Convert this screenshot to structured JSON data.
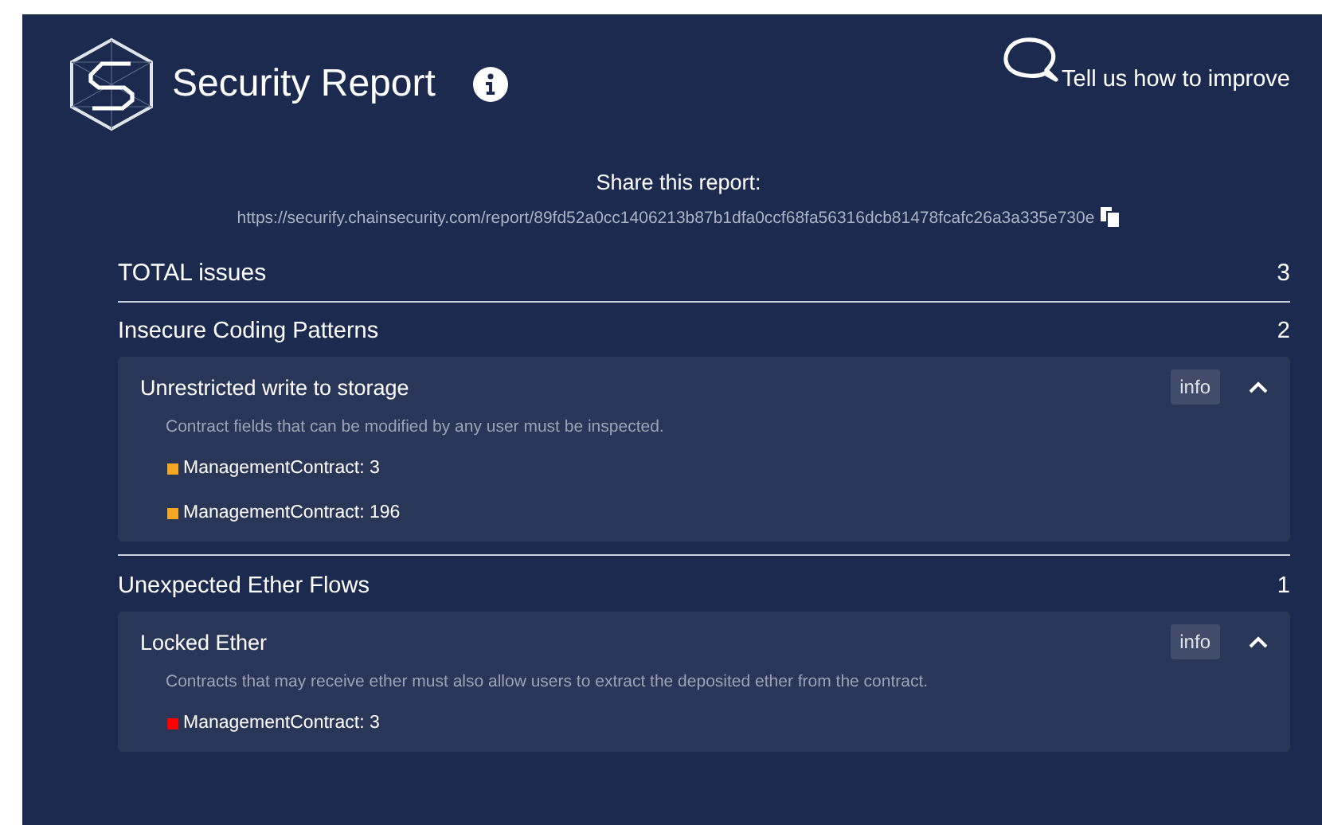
{
  "header": {
    "title": "Security Report",
    "feedback": "Tell us how to improve"
  },
  "share": {
    "heading": "Share this report:",
    "url": "https://securify.chainsecurity.com/report/89fd52a0cc1406213b87b1dfa0ccf68fa56316dcb81478fcafc26a3a335e730e"
  },
  "total": {
    "label": "TOTAL issues",
    "count": "3"
  },
  "sections": [
    {
      "title": "Insecure Coding Patterns",
      "count": "2",
      "issues": [
        {
          "title": "Unrestricted write to storage",
          "info": "info",
          "expanded": true,
          "description": "Contract fields that can be modified by any user must be inspected.",
          "locations": [
            {
              "text": "ManagementContract: 3",
              "color": "#f5a623"
            },
            {
              "text": "ManagementContract: 196",
              "color": "#f5a623"
            }
          ]
        }
      ]
    },
    {
      "title": "Unexpected Ether Flows",
      "count": "1",
      "issues": [
        {
          "title": "Locked Ether",
          "info": "info",
          "expanded": true,
          "description": "Contracts that may receive ether must also allow users to extract the deposited ether from the contract.",
          "locations": [
            {
              "text": "ManagementContract: 3",
              "color": "#ff0000"
            }
          ]
        }
      ]
    }
  ]
}
